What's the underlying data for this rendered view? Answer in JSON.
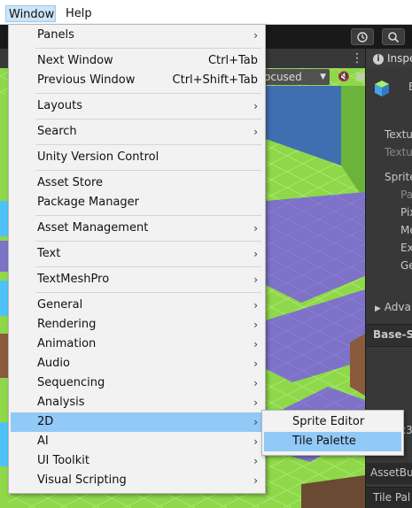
{
  "menubar": {
    "items": [
      {
        "label": "Window",
        "active": true
      },
      {
        "label": "Help",
        "active": false
      }
    ]
  },
  "scene": {
    "view_dropdown": "ocused",
    "colors": {
      "grass": "#8ed84a",
      "grass_line": "#a9e86a",
      "water": "#7d72c8",
      "dirt": "#8a5a3c",
      "wall_blue": "#3f6fb0",
      "sky": "#4fc3f7"
    }
  },
  "inspector": {
    "tab_label": "Inspe",
    "title_fragment": "E",
    "rows": [
      {
        "text": "Textu",
        "dim": false
      },
      {
        "text": "Textu",
        "dim": true
      },
      {
        "text": "Sprite",
        "dim": false
      },
      {
        "text": "Pa",
        "dim": true
      },
      {
        "text": "Pix",
        "dim": false
      },
      {
        "text": "Me",
        "dim": false
      },
      {
        "text": "Ext",
        "dim": false
      },
      {
        "text": "Ge",
        "dim": false
      }
    ],
    "advanced": "Adva",
    "section": "Base-S",
    "size_fragment": "x3",
    "bottom1": "AssetBu",
    "bottom2": "Tile Pal"
  },
  "window_menu": {
    "items": [
      {
        "label": "Panels",
        "shortcut": "",
        "submenu": true,
        "highlight": false
      },
      {
        "label": "Next Window",
        "shortcut": "Ctrl+Tab",
        "submenu": false,
        "highlight": false
      },
      {
        "label": "Previous Window",
        "shortcut": "Ctrl+Shift+Tab",
        "submenu": false,
        "highlight": false
      },
      {
        "label": "Layouts",
        "shortcut": "",
        "submenu": true,
        "highlight": false
      },
      {
        "label": "Search",
        "shortcut": "",
        "submenu": true,
        "highlight": false
      },
      {
        "label": "Unity Version Control",
        "shortcut": "",
        "submenu": false,
        "highlight": false
      },
      {
        "label": "Asset Store",
        "shortcut": "",
        "submenu": false,
        "highlight": false
      },
      {
        "label": "Package Manager",
        "shortcut": "",
        "submenu": false,
        "highlight": false
      },
      {
        "label": "Asset Management",
        "shortcut": "",
        "submenu": true,
        "highlight": false
      },
      {
        "label": "Text",
        "shortcut": "",
        "submenu": true,
        "highlight": false
      },
      {
        "label": "TextMeshPro",
        "shortcut": "",
        "submenu": true,
        "highlight": false
      },
      {
        "label": "General",
        "shortcut": "",
        "submenu": true,
        "highlight": false
      },
      {
        "label": "Rendering",
        "shortcut": "",
        "submenu": true,
        "highlight": false
      },
      {
        "label": "Animation",
        "shortcut": "",
        "submenu": true,
        "highlight": false
      },
      {
        "label": "Audio",
        "shortcut": "",
        "submenu": true,
        "highlight": false
      },
      {
        "label": "Sequencing",
        "shortcut": "",
        "submenu": true,
        "highlight": false
      },
      {
        "label": "Analysis",
        "shortcut": "",
        "submenu": true,
        "highlight": false
      },
      {
        "label": "2D",
        "shortcut": "",
        "submenu": true,
        "highlight": true
      },
      {
        "label": "AI",
        "shortcut": "",
        "submenu": true,
        "highlight": false
      },
      {
        "label": "UI Toolkit",
        "shortcut": "",
        "submenu": true,
        "highlight": false
      },
      {
        "label": "Visual Scripting",
        "shortcut": "",
        "submenu": true,
        "highlight": false
      }
    ],
    "arrow_glyph": "›"
  },
  "submenu_2d": {
    "items": [
      {
        "label": "Sprite Editor",
        "highlight": false
      },
      {
        "label": "Tile Palette",
        "highlight": true
      }
    ]
  },
  "icons": {
    "history": "history-icon",
    "search": "search-icon",
    "more": "more-options-icon"
  }
}
